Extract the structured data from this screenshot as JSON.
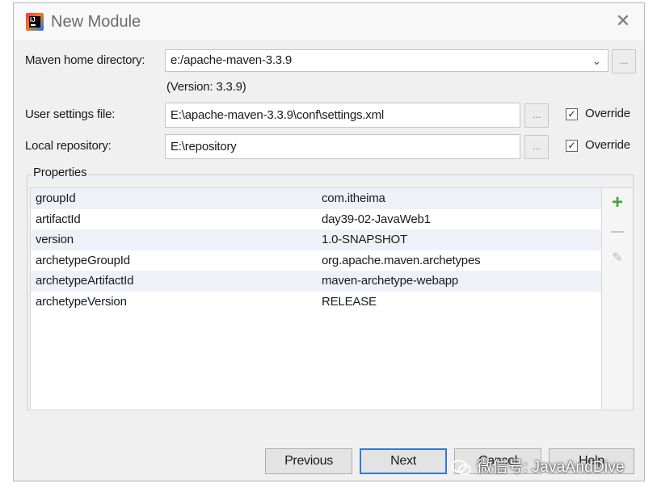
{
  "dialog": {
    "title": "New Module",
    "close_glyph": "✕",
    "app_icon": "intellij-idea-icon"
  },
  "maven_home": {
    "label": "Maven home directory:",
    "value": "e:/apache-maven-3.3.9",
    "version": "(Version: 3.3.9)",
    "browse": "..."
  },
  "user_settings": {
    "label": "User settings file:",
    "value": "E:\\apache-maven-3.3.9\\conf\\settings.xml",
    "browse": "...",
    "override_label": "Override",
    "override_checked": true
  },
  "local_repo": {
    "label": "Local repository:",
    "value": "E:\\repository",
    "browse": "...",
    "override_label": "Override",
    "override_checked": true
  },
  "properties": {
    "label": "Properties",
    "rows": [
      {
        "key": "groupId",
        "value": "com.itheima"
      },
      {
        "key": "artifactId",
        "value": "day39-02-JavaWeb1"
      },
      {
        "key": "version",
        "value": "1.0-SNAPSHOT"
      },
      {
        "key": "archetypeGroupId",
        "value": "org.apache.maven.archetypes"
      },
      {
        "key": "archetypeArtifactId",
        "value": "maven-archetype-webapp"
      },
      {
        "key": "archetypeVersion",
        "value": "RELEASE"
      }
    ],
    "tools": {
      "add": "+",
      "edit": "✎"
    }
  },
  "buttons": {
    "previous": "Previous",
    "next": "Next",
    "cancel": "Cancel",
    "help": "Help"
  },
  "watermark": {
    "text": "微信号: JavaAndDive"
  },
  "colors": {
    "accent": "#2f7ad7",
    "add": "#3ba53b",
    "stripe": "#eef2f8"
  }
}
